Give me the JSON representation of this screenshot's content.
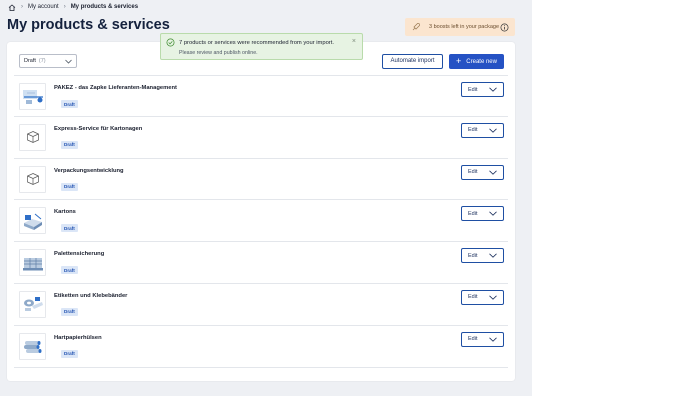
{
  "breadcrumb": {
    "home_icon": "home-icon",
    "items": [
      "My account",
      "My products & services"
    ]
  },
  "page": {
    "title": "My products & services"
  },
  "boosts": {
    "text": "3 boosts left in your package",
    "icon": "rocket-icon",
    "info_icon": "info-icon"
  },
  "toast": {
    "title": "7 products or services were recommended from your import.",
    "subtitle": "Please review and publish online.",
    "close": "×"
  },
  "toolbar": {
    "filter_value": "Draft",
    "filter_count": "(7)",
    "import_label": "Automate import",
    "create_label": "Create new",
    "create_icon": "+"
  },
  "products": [
    {
      "name": "PAKEZ - das Zapke Lieferanten-Management",
      "status": "Draft",
      "edit": "Edit",
      "thumb": "illustration"
    },
    {
      "name": "Express-Service für Kartonagen",
      "status": "Draft",
      "edit": "Edit",
      "thumb": "box-icon"
    },
    {
      "name": "Verpackungsentwicklung",
      "status": "Draft",
      "edit": "Edit",
      "thumb": "box-icon"
    },
    {
      "name": "Kartons",
      "status": "Draft",
      "edit": "Edit",
      "thumb": "illustration"
    },
    {
      "name": "Palettensicherung",
      "status": "Draft",
      "edit": "Edit",
      "thumb": "illustration"
    },
    {
      "name": "Etiketten und Klebebänder",
      "status": "Draft",
      "edit": "Edit",
      "thumb": "illustration"
    },
    {
      "name": "Hartpapierhülsen",
      "status": "Draft",
      "edit": "Edit",
      "thumb": "illustration"
    }
  ],
  "colors": {
    "primary": "#2552c4",
    "success_bg": "#e7f3e3",
    "badge_bg": "#dbe6f7",
    "boost_bg": "#fbe5cf"
  }
}
